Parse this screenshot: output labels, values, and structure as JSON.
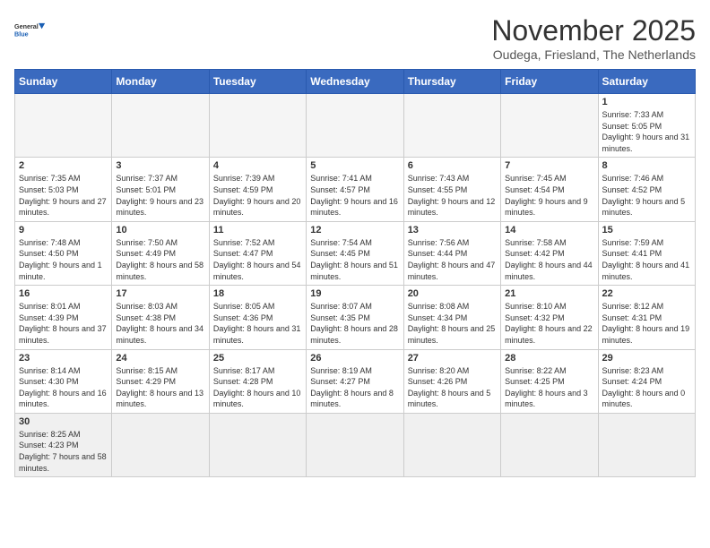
{
  "header": {
    "logo_general": "General",
    "logo_blue": "Blue",
    "month_title": "November 2025",
    "location": "Oudega, Friesland, The Netherlands"
  },
  "weekdays": [
    "Sunday",
    "Monday",
    "Tuesday",
    "Wednesday",
    "Thursday",
    "Friday",
    "Saturday"
  ],
  "days": {
    "d1": {
      "num": "1",
      "sunrise": "7:33 AM",
      "sunset": "5:05 PM",
      "daylight": "9 hours and 31 minutes."
    },
    "d2": {
      "num": "2",
      "sunrise": "7:35 AM",
      "sunset": "5:03 PM",
      "daylight": "9 hours and 27 minutes."
    },
    "d3": {
      "num": "3",
      "sunrise": "7:37 AM",
      "sunset": "5:01 PM",
      "daylight": "9 hours and 23 minutes."
    },
    "d4": {
      "num": "4",
      "sunrise": "7:39 AM",
      "sunset": "4:59 PM",
      "daylight": "9 hours and 20 minutes."
    },
    "d5": {
      "num": "5",
      "sunrise": "7:41 AM",
      "sunset": "4:57 PM",
      "daylight": "9 hours and 16 minutes."
    },
    "d6": {
      "num": "6",
      "sunrise": "7:43 AM",
      "sunset": "4:55 PM",
      "daylight": "9 hours and 12 minutes."
    },
    "d7": {
      "num": "7",
      "sunrise": "7:45 AM",
      "sunset": "4:54 PM",
      "daylight": "9 hours and 9 minutes."
    },
    "d8": {
      "num": "8",
      "sunrise": "7:46 AM",
      "sunset": "4:52 PM",
      "daylight": "9 hours and 5 minutes."
    },
    "d9": {
      "num": "9",
      "sunrise": "7:48 AM",
      "sunset": "4:50 PM",
      "daylight": "9 hours and 1 minute."
    },
    "d10": {
      "num": "10",
      "sunrise": "7:50 AM",
      "sunset": "4:49 PM",
      "daylight": "8 hours and 58 minutes."
    },
    "d11": {
      "num": "11",
      "sunrise": "7:52 AM",
      "sunset": "4:47 PM",
      "daylight": "8 hours and 54 minutes."
    },
    "d12": {
      "num": "12",
      "sunrise": "7:54 AM",
      "sunset": "4:45 PM",
      "daylight": "8 hours and 51 minutes."
    },
    "d13": {
      "num": "13",
      "sunrise": "7:56 AM",
      "sunset": "4:44 PM",
      "daylight": "8 hours and 47 minutes."
    },
    "d14": {
      "num": "14",
      "sunrise": "7:58 AM",
      "sunset": "4:42 PM",
      "daylight": "8 hours and 44 minutes."
    },
    "d15": {
      "num": "15",
      "sunrise": "7:59 AM",
      "sunset": "4:41 PM",
      "daylight": "8 hours and 41 minutes."
    },
    "d16": {
      "num": "16",
      "sunrise": "8:01 AM",
      "sunset": "4:39 PM",
      "daylight": "8 hours and 37 minutes."
    },
    "d17": {
      "num": "17",
      "sunrise": "8:03 AM",
      "sunset": "4:38 PM",
      "daylight": "8 hours and 34 minutes."
    },
    "d18": {
      "num": "18",
      "sunrise": "8:05 AM",
      "sunset": "4:36 PM",
      "daylight": "8 hours and 31 minutes."
    },
    "d19": {
      "num": "19",
      "sunrise": "8:07 AM",
      "sunset": "4:35 PM",
      "daylight": "8 hours and 28 minutes."
    },
    "d20": {
      "num": "20",
      "sunrise": "8:08 AM",
      "sunset": "4:34 PM",
      "daylight": "8 hours and 25 minutes."
    },
    "d21": {
      "num": "21",
      "sunrise": "8:10 AM",
      "sunset": "4:32 PM",
      "daylight": "8 hours and 22 minutes."
    },
    "d22": {
      "num": "22",
      "sunrise": "8:12 AM",
      "sunset": "4:31 PM",
      "daylight": "8 hours and 19 minutes."
    },
    "d23": {
      "num": "23",
      "sunrise": "8:14 AM",
      "sunset": "4:30 PM",
      "daylight": "8 hours and 16 minutes."
    },
    "d24": {
      "num": "24",
      "sunrise": "8:15 AM",
      "sunset": "4:29 PM",
      "daylight": "8 hours and 13 minutes."
    },
    "d25": {
      "num": "25",
      "sunrise": "8:17 AM",
      "sunset": "4:28 PM",
      "daylight": "8 hours and 10 minutes."
    },
    "d26": {
      "num": "26",
      "sunrise": "8:19 AM",
      "sunset": "4:27 PM",
      "daylight": "8 hours and 8 minutes."
    },
    "d27": {
      "num": "27",
      "sunrise": "8:20 AM",
      "sunset": "4:26 PM",
      "daylight": "8 hours and 5 minutes."
    },
    "d28": {
      "num": "28",
      "sunrise": "8:22 AM",
      "sunset": "4:25 PM",
      "daylight": "8 hours and 3 minutes."
    },
    "d29": {
      "num": "29",
      "sunrise": "8:23 AM",
      "sunset": "4:24 PM",
      "daylight": "8 hours and 0 minutes."
    },
    "d30": {
      "num": "30",
      "sunrise": "8:25 AM",
      "sunset": "4:23 PM",
      "daylight": "7 hours and 58 minutes."
    }
  }
}
